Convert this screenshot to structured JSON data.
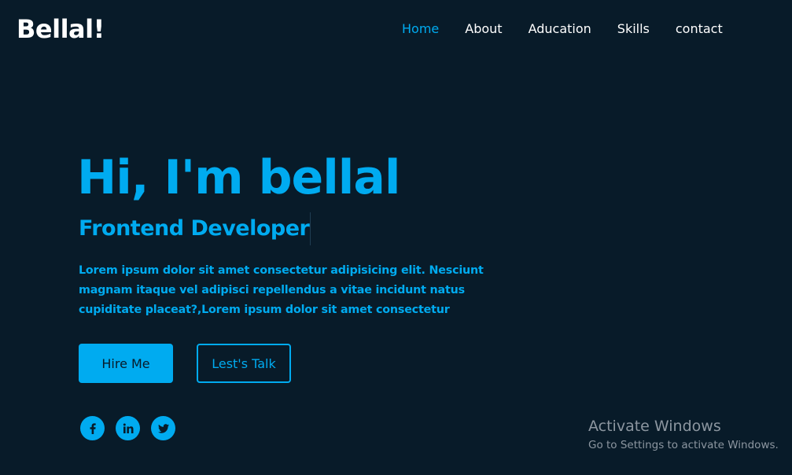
{
  "header": {
    "logo": "Bellal!",
    "nav": [
      {
        "label": "Home",
        "active": true
      },
      {
        "label": "About",
        "active": false
      },
      {
        "label": "Aducation",
        "active": false
      },
      {
        "label": "Skills",
        "active": false
      },
      {
        "label": "contact",
        "active": false
      }
    ]
  },
  "hero": {
    "title": "Hi, I'm bellal",
    "subtitle": "Frontend Developer",
    "description": "Lorem ipsum dolor sit amet consectetur adipisicing elit. Nesciunt magnam itaque vel adipisci repellendus a vitae incidunt natus cupiditate placeat?,Lorem ipsum dolor sit amet consectetur",
    "buttons": {
      "primary": "Hire Me",
      "secondary": "Lest's Talk"
    },
    "socials": [
      {
        "icon": "facebook-icon"
      },
      {
        "icon": "linkedin-icon"
      },
      {
        "icon": "twitter-icon"
      }
    ]
  },
  "watermark": {
    "title": "Activate Windows",
    "subtitle": "Go to Settings to activate Windows."
  },
  "colors": {
    "background": "#081b29",
    "accent": "#00abf0",
    "text": "#ffffff",
    "watermark": "#8c96a0"
  }
}
